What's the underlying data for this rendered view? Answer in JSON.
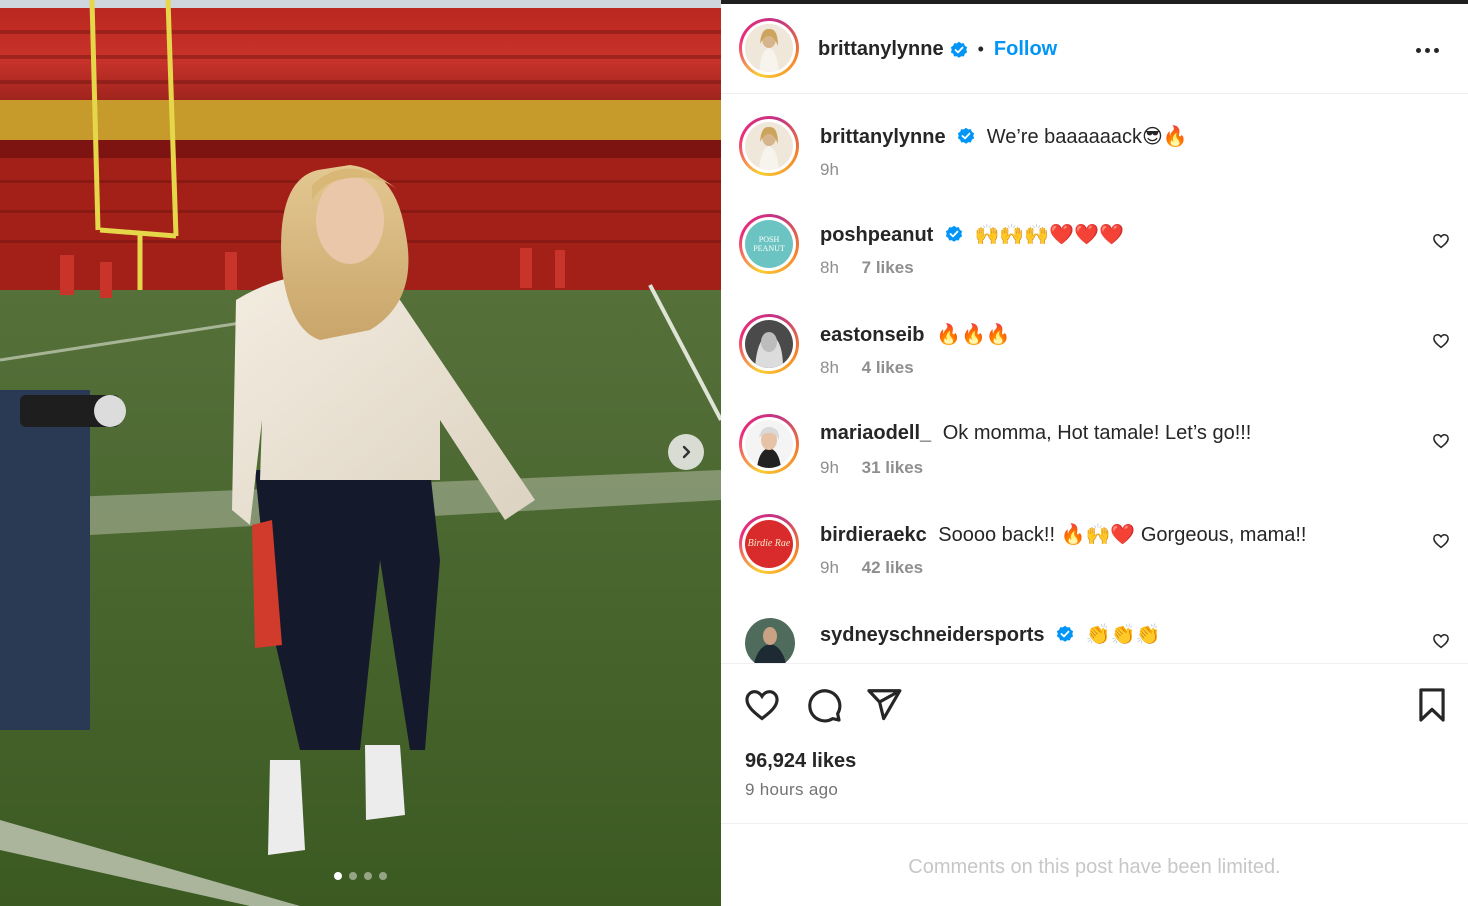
{
  "post": {
    "author": "brittanylynne",
    "follow_label": "Follow",
    "bullet": "•",
    "caption": "We’re baaaaaack😎🔥",
    "caption_time": "9h"
  },
  "media": {
    "slides": 4,
    "active_slide": 1,
    "next_icon": "chevron-right-icon"
  },
  "comments": [
    {
      "user": "poshpeanut",
      "verified": true,
      "text": "🙌🙌🙌❤️❤️❤️",
      "time": "8h",
      "likes": "7 likes",
      "avatar_text": "POSH PEANUT",
      "avatar_color": "#6cc4c2"
    },
    {
      "user": "eastonseib",
      "verified": false,
      "text": "🔥🔥🔥",
      "time": "8h",
      "likes": "4 likes"
    },
    {
      "user": "mariaodell_",
      "verified": false,
      "text": "Ok momma, Hot tamale! Let’s go!!!",
      "time": "9h",
      "likes": "31 likes"
    },
    {
      "user": "birdieraekc",
      "verified": false,
      "text": "Soooo back!! 🔥🙌❤️ Gorgeous, mama!!",
      "time": "9h",
      "likes": "42 likes",
      "avatar_text": "Birdie Rae",
      "avatar_color": "#d92b2b"
    },
    {
      "user": "sydneyschneidersports",
      "verified": true,
      "text": "👏👏👏",
      "time": "",
      "likes": ""
    }
  ],
  "actions": {
    "like_icon": "heart-icon",
    "comment_icon": "comment-icon",
    "share_icon": "send-icon",
    "save_icon": "bookmark-icon"
  },
  "stats": {
    "likes": "96,924 likes",
    "time_ago": "9 hours ago"
  },
  "footer": {
    "limited_text": "Comments on this post have been limited."
  },
  "colors": {
    "link_blue": "#0095f6",
    "verified_blue": "#0095f6",
    "muted": "#8e8e8e"
  }
}
